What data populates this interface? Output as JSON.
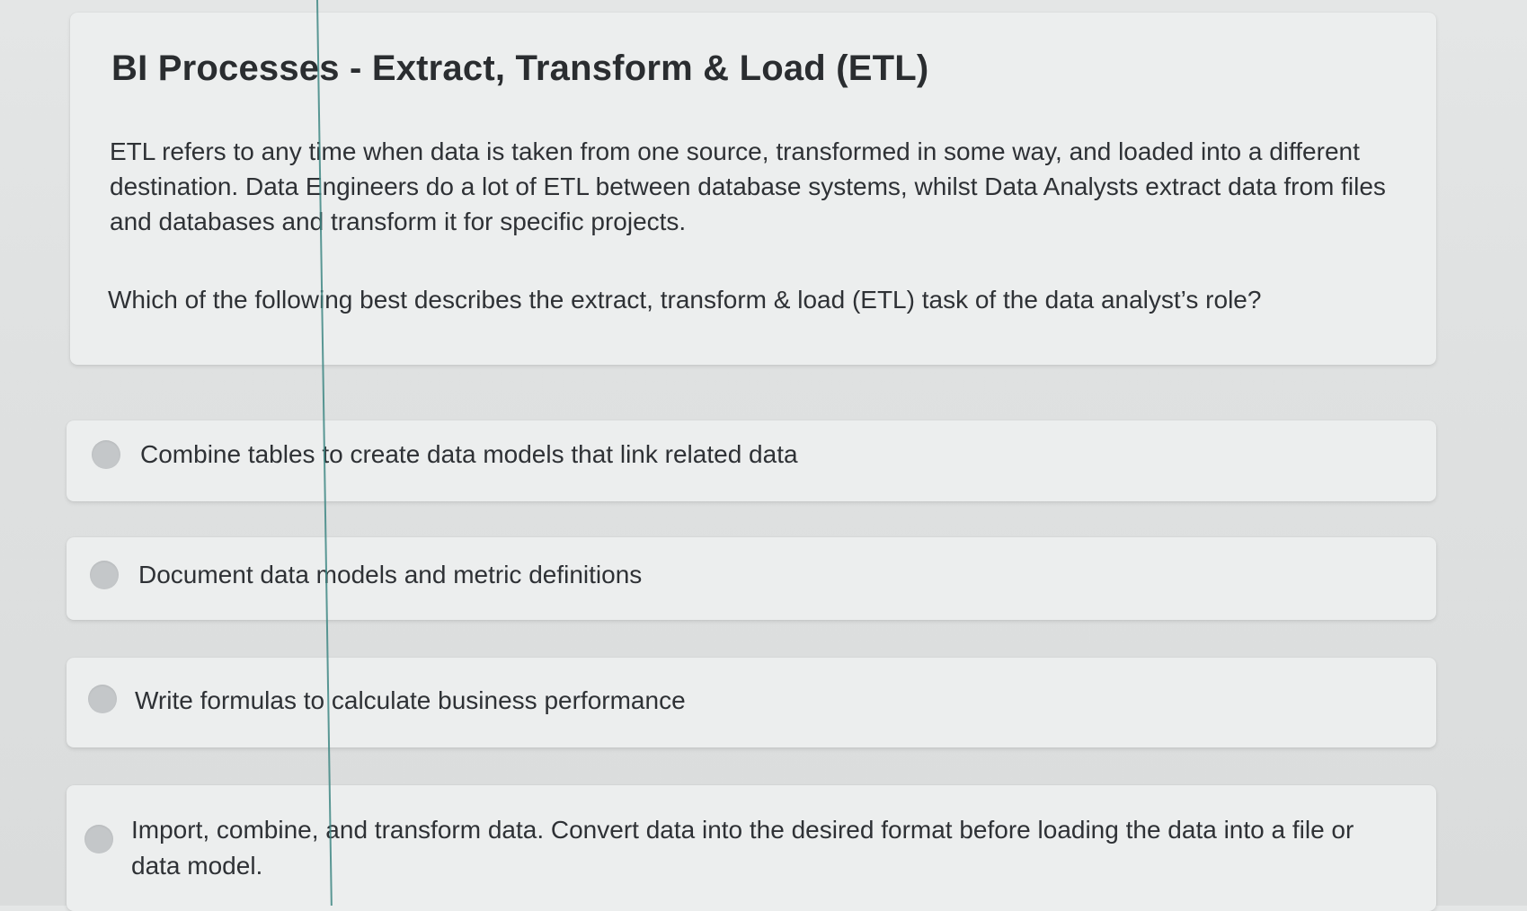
{
  "question": {
    "title": "BI Processes  - Extract, Transform & Load (ETL)",
    "intro": "ETL refers to any time when data is taken from one source, transformed in some way, and loaded into a different destination. Data Engineers do a lot of ETL between database systems, whilst Data Analysts extract data from files and databases and transform it for specific projects.",
    "prompt": "Which of the following best describes the extract, transform & load (ETL) task of the data analyst’s role?"
  },
  "options": [
    {
      "label": "Combine tables to create data models that link related data",
      "selected": false
    },
    {
      "label": "Document data models and metric definitions",
      "selected": false
    },
    {
      "label": "Write formulas to calculate business performance",
      "selected": false
    },
    {
      "label": "Import, combine, and transform data. Convert data into the desired format before loading the data into a file or data model.",
      "selected": false
    }
  ],
  "colors": {
    "page_background": "#e1e3e3",
    "card_background": "#eceeee",
    "radio_unselected": "#c4c7c9",
    "text": "#2e3135",
    "screen_line": "#3f8784"
  }
}
